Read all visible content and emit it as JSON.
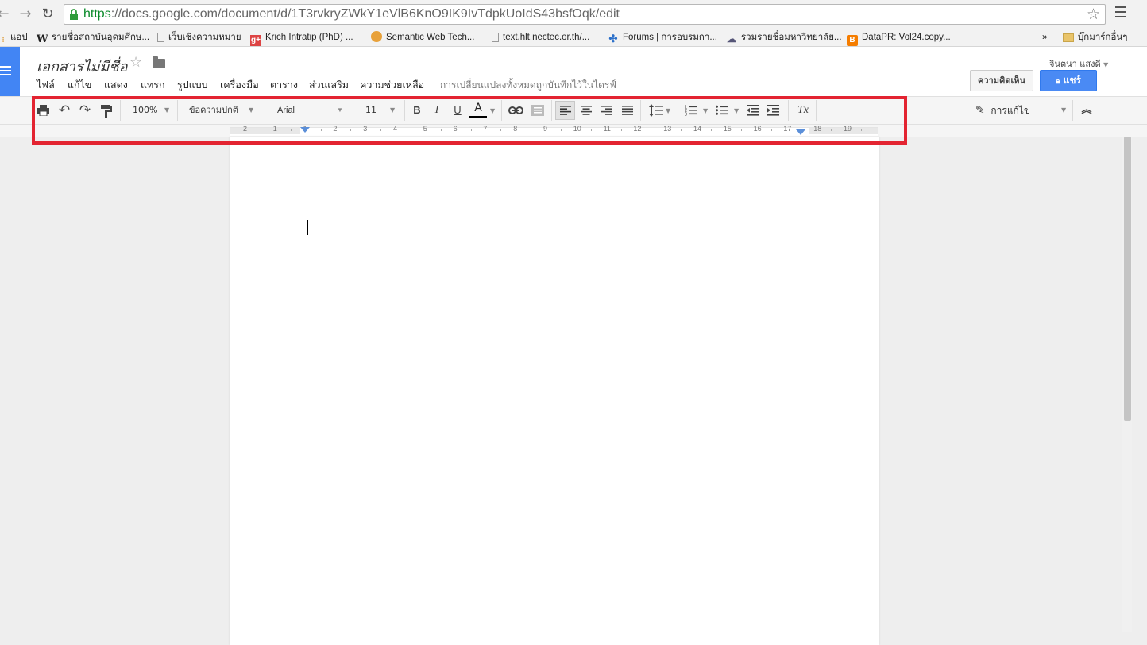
{
  "browser": {
    "url_scheme": "https",
    "url_rest": "://docs.google.com/document/d/1T3rvkryZWkY1eVlB6KnO9IK9IvTdpkUoIdS43bsfOqk/edit",
    "bookmarks": [
      {
        "label": "แอป",
        "icon": "apps-icon"
      },
      {
        "label": "รายชื่อสถาบันอุดมศึกษ...",
        "icon": "wikipedia-icon"
      },
      {
        "label": "เว็บเชิงความหมาย",
        "icon": "page-icon"
      },
      {
        "label": "Krich Intratip (PhD) ...",
        "icon": "google-plus-icon"
      },
      {
        "label": "Semantic Web Tech...",
        "icon": "semantic-icon"
      },
      {
        "label": "text.hlt.nectec.or.th/...",
        "icon": "page-icon"
      },
      {
        "label": "Forums | การอบรมกา...",
        "icon": "forums-icon"
      },
      {
        "label": "รวมรายชื่อมหาวิทยาลัย...",
        "icon": "cloud-icon"
      },
      {
        "label": "DataPR: Vol24.copy...",
        "icon": "blogger-icon"
      }
    ],
    "bookmarks_overflow": "»",
    "other_bookmarks": "บุ๊กมาร์กอื่นๆ"
  },
  "docs": {
    "title": "เอกสารไม่มีชื่อ",
    "menus": [
      "ไฟล์",
      "แก้ไข",
      "แสดง",
      "แทรก",
      "รูปแบบ",
      "เครื่องมือ",
      "ตาราง",
      "ส่วนเสริม",
      "ความช่วยเหลือ"
    ],
    "save_status": "การเปลี่ยนแปลงทั้งหมดถูกบันทึกไว้ในไดรฟ์",
    "user_name": "จินตนา แสงดี",
    "comments_label": "ความคิดเห็น",
    "share_label": "แชร์"
  },
  "toolbar": {
    "zoom": "100%",
    "style": "ข้อความปกติ",
    "font": "Arial",
    "font_size": "11",
    "bold": "B",
    "italic": "I",
    "underline": "U",
    "text_color": "A",
    "clear_format": "Tx",
    "edit_mode": "การแก้ไข"
  },
  "ruler": {
    "numbers": [
      "2",
      "1",
      "1",
      "2",
      "3",
      "4",
      "5",
      "6",
      "7",
      "8",
      "9",
      "10",
      "11",
      "12",
      "13",
      "14",
      "15",
      "16",
      "17",
      "18",
      "19"
    ]
  },
  "colors": {
    "accent": "#4285f4",
    "share": "#4a8af4",
    "highlight": "#e32431",
    "url_green": "#0a8a2a"
  }
}
